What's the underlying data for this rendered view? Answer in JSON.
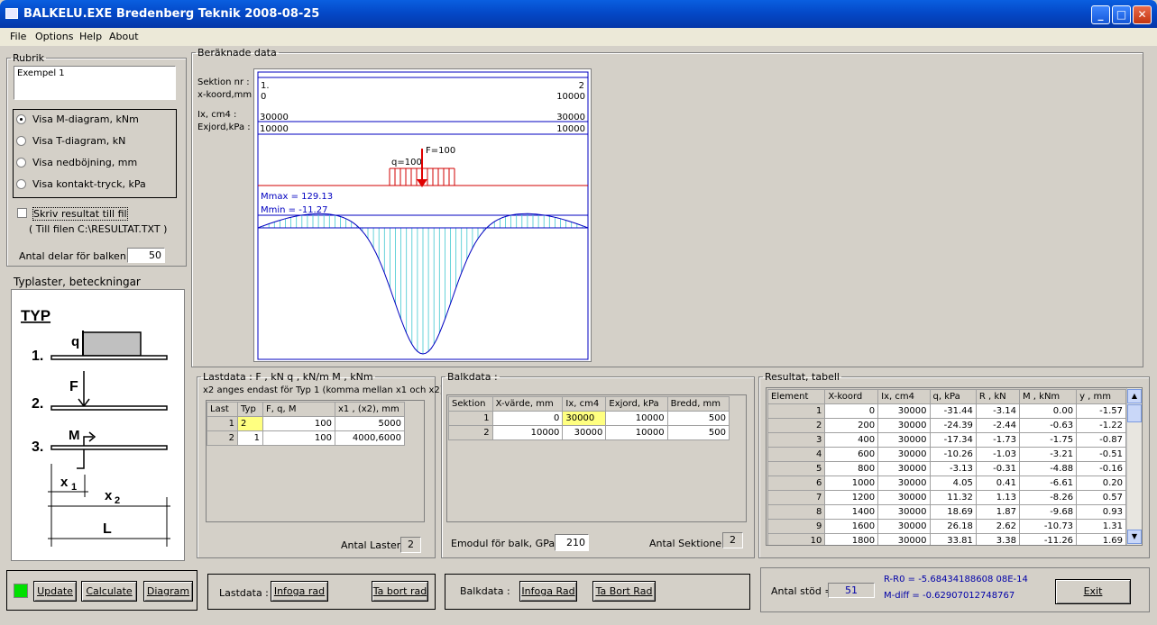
{
  "window": {
    "title": "BALKELU.EXE    Bredenberg Teknik  2008-08-25",
    "min": "_",
    "max": "□",
    "close": "✕"
  },
  "menu": [
    "File",
    "Options",
    "Help",
    "About"
  ],
  "rubrik": {
    "legend": "Rubrik",
    "value": "Exempel 1"
  },
  "diagram_options": [
    {
      "label": "Visa M-diagram, kNm",
      "selected": true
    },
    {
      "label": "Visa T-diagram,  kN",
      "selected": false
    },
    {
      "label": "Visa nedböjning,  mm",
      "selected": false
    },
    {
      "label": "Visa kontakt-tryck, kPa",
      "selected": false
    }
  ],
  "write_file": {
    "label": "Skriv resultat till fil",
    "sub": "( Till filen C:\\RESULTAT.TXT )",
    "checked": false
  },
  "parts": {
    "label": "Antal delar för balken :",
    "value": "50"
  },
  "typlaster": {
    "title": "Typlaster, beteckningar",
    "heading": "TYP",
    "n1": "1.",
    "n2": "2.",
    "n3": "3.",
    "q": "q",
    "F": "F",
    "M": "M",
    "x1": "x",
    "x1s": "1",
    "x2": "x",
    "x2s": "2",
    "L": "L"
  },
  "computed": {
    "legend": "Beräknade data",
    "labels": {
      "section": "Sektion nr :",
      "xkoord": "x-koord,mm :",
      "ix": "Ix, cm4 :",
      "exjord": "Exjord,kPa :"
    },
    "values": {
      "s1": "1.",
      "s2": "2",
      "x1": "0",
      "x2": "10000",
      "ix1": "30000",
      "ix2": "30000",
      "e1": "10000",
      "e2": "10000",
      "q": "q=100",
      "F": "F=100",
      "mmax": "Mmax = 129.13",
      "mmin": "Mmin = -11.27"
    }
  },
  "lastdata": {
    "legend": "Lastdata : F , kN     q , kN/m     M , kNm",
    "note": "x2 anges endast för Typ 1 (komma mellan x1 och x2)",
    "headers": [
      "Last",
      "Typ",
      "F, q, M",
      "x1 , (x2),  mm"
    ],
    "rows": [
      [
        "1",
        "2",
        "100",
        "5000"
      ],
      [
        "2",
        "1",
        "100",
        "4000,6000"
      ]
    ],
    "count_label": "Antal Laster :",
    "count": "2"
  },
  "balkdata": {
    "legend": "Balkdata :",
    "headers": [
      "Sektion",
      "X-värde, mm",
      "Ix, cm4",
      "Exjord, kPa",
      "Bredd, mm"
    ],
    "rows": [
      [
        "1",
        "0",
        "30000",
        "10000",
        "500"
      ],
      [
        "2",
        "10000",
        "30000",
        "10000",
        "500"
      ]
    ],
    "emodul_label": "Emodul för balk, GPa =",
    "emodul": "210",
    "count_label": "Antal Sektioner :",
    "count": "2"
  },
  "resultat": {
    "legend": "Resultat, tabell",
    "headers": [
      "Element",
      "X-koord",
      "Ix, cm4",
      "q, kPa",
      "R , kN",
      "M , kNm",
      "y , mm"
    ],
    "rows": [
      [
        "1",
        "0",
        "30000",
        "-31.44",
        "-3.14",
        "0.00",
        "-1.57"
      ],
      [
        "2",
        "200",
        "30000",
        "-24.39",
        "-2.44",
        "-0.63",
        "-1.22"
      ],
      [
        "3",
        "400",
        "30000",
        "-17.34",
        "-1.73",
        "-1.75",
        "-0.87"
      ],
      [
        "4",
        "600",
        "30000",
        "-10.26",
        "-1.03",
        "-3.21",
        "-0.51"
      ],
      [
        "5",
        "800",
        "30000",
        "-3.13",
        "-0.31",
        "-4.88",
        "-0.16"
      ],
      [
        "6",
        "1000",
        "30000",
        "4.05",
        "0.41",
        "-6.61",
        "0.20"
      ],
      [
        "7",
        "1200",
        "30000",
        "11.32",
        "1.13",
        "-8.26",
        "0.57"
      ],
      [
        "8",
        "1400",
        "30000",
        "18.69",
        "1.87",
        "-9.68",
        "0.93"
      ],
      [
        "9",
        "1600",
        "30000",
        "26.18",
        "2.62",
        "-10.73",
        "1.31"
      ],
      [
        "10",
        "1800",
        "30000",
        "33.81",
        "3.38",
        "-11.26",
        "1.69"
      ]
    ]
  },
  "bottom": {
    "update": "Update",
    "calculate": "Calculate",
    "diagram": "Diagram",
    "lastdata_label": "Lastdata :",
    "infoga": "Infoga rad",
    "tabort": "Ta bort rad",
    "balkdata_label": "Balkdata :",
    "infoga2": "Infoga Rad",
    "tabort2": "Ta Bort Rad",
    "stod_label": "Antal stöd =",
    "stod": "51",
    "r0": "R-R0 = -5.68434188608 08E-14",
    "mdiff": "M-diff = -0.62907012748767",
    "exit": "Exit"
  }
}
